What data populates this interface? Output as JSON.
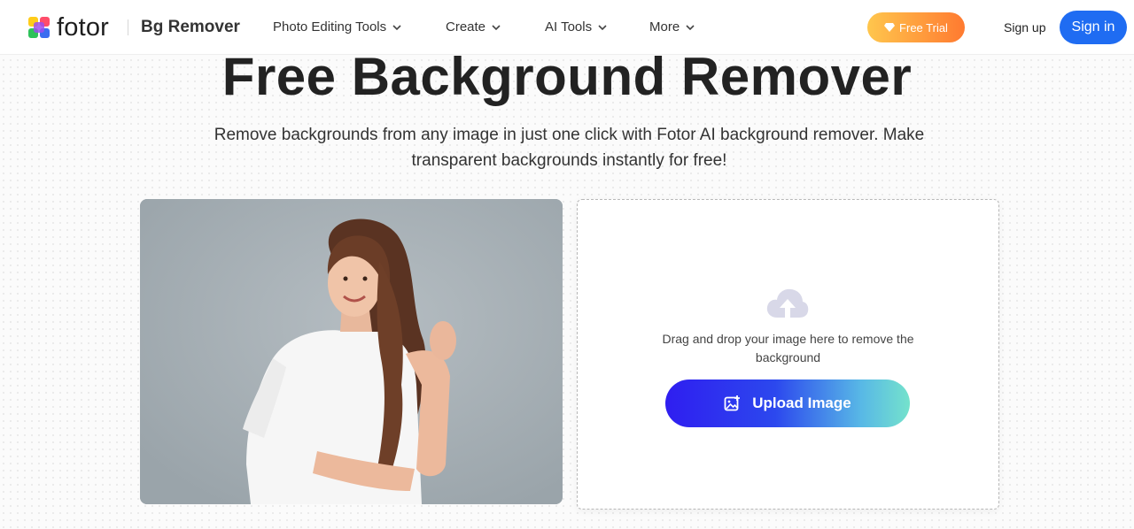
{
  "header": {
    "logo_text": "fotor",
    "product_name": "Bg Remover",
    "nav": [
      {
        "label": "Photo Editing Tools",
        "icon": "chevron-down-icon"
      },
      {
        "label": "Create",
        "icon": "chevron-down-icon"
      },
      {
        "label": "AI Tools",
        "icon": "chevron-down-icon"
      },
      {
        "label": "More",
        "icon": "chevron-down-icon"
      }
    ],
    "free_trial_label": "Free Trial",
    "free_trial_icon": "diamond-icon",
    "sign_up_label": "Sign up",
    "sign_in_label": "Sign in"
  },
  "hero": {
    "title": "Free Background Remover",
    "subtitle": "Remove backgrounds from any image in just one click with Fotor AI background remover. Make transparent backgrounds instantly for free!"
  },
  "upload": {
    "icon": "cloud-upload-icon",
    "drop_text": "Drag and drop your image here to remove the background",
    "button_label": "Upload Image",
    "button_icon": "add-image-icon"
  },
  "colors": {
    "brand_blue": "#1f6cf2",
    "trial_gradient_start": "#ffc64d",
    "trial_gradient_end": "#ff7a30",
    "upload_gradient_start": "#2f1ef0",
    "upload_gradient_end": "#74e2cc"
  }
}
